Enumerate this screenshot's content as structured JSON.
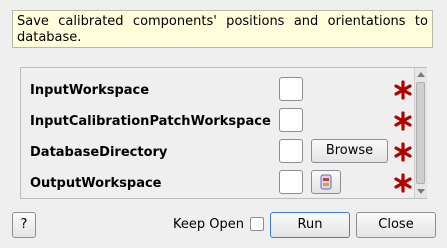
{
  "description": "Save calibrated components' positions and orientations to database.",
  "properties": [
    {
      "label": "InputWorkspace"
    },
    {
      "label": "InputCalibrationPatchWorkspace"
    },
    {
      "label": "DatabaseDirectory",
      "button_label": "Browse"
    },
    {
      "label": "OutputWorkspace",
      "button_icon": "workspace-icon"
    }
  ],
  "required_marker": "asterisk-icon",
  "colors": {
    "required": "#b00000",
    "description_bg": "#ffffdc",
    "focus_border": "#3d7fd6"
  },
  "footer": {
    "help_label": "?",
    "keep_open_label": "Keep Open",
    "keep_open_checked": false,
    "run_label": "Run",
    "close_label": "Close"
  }
}
